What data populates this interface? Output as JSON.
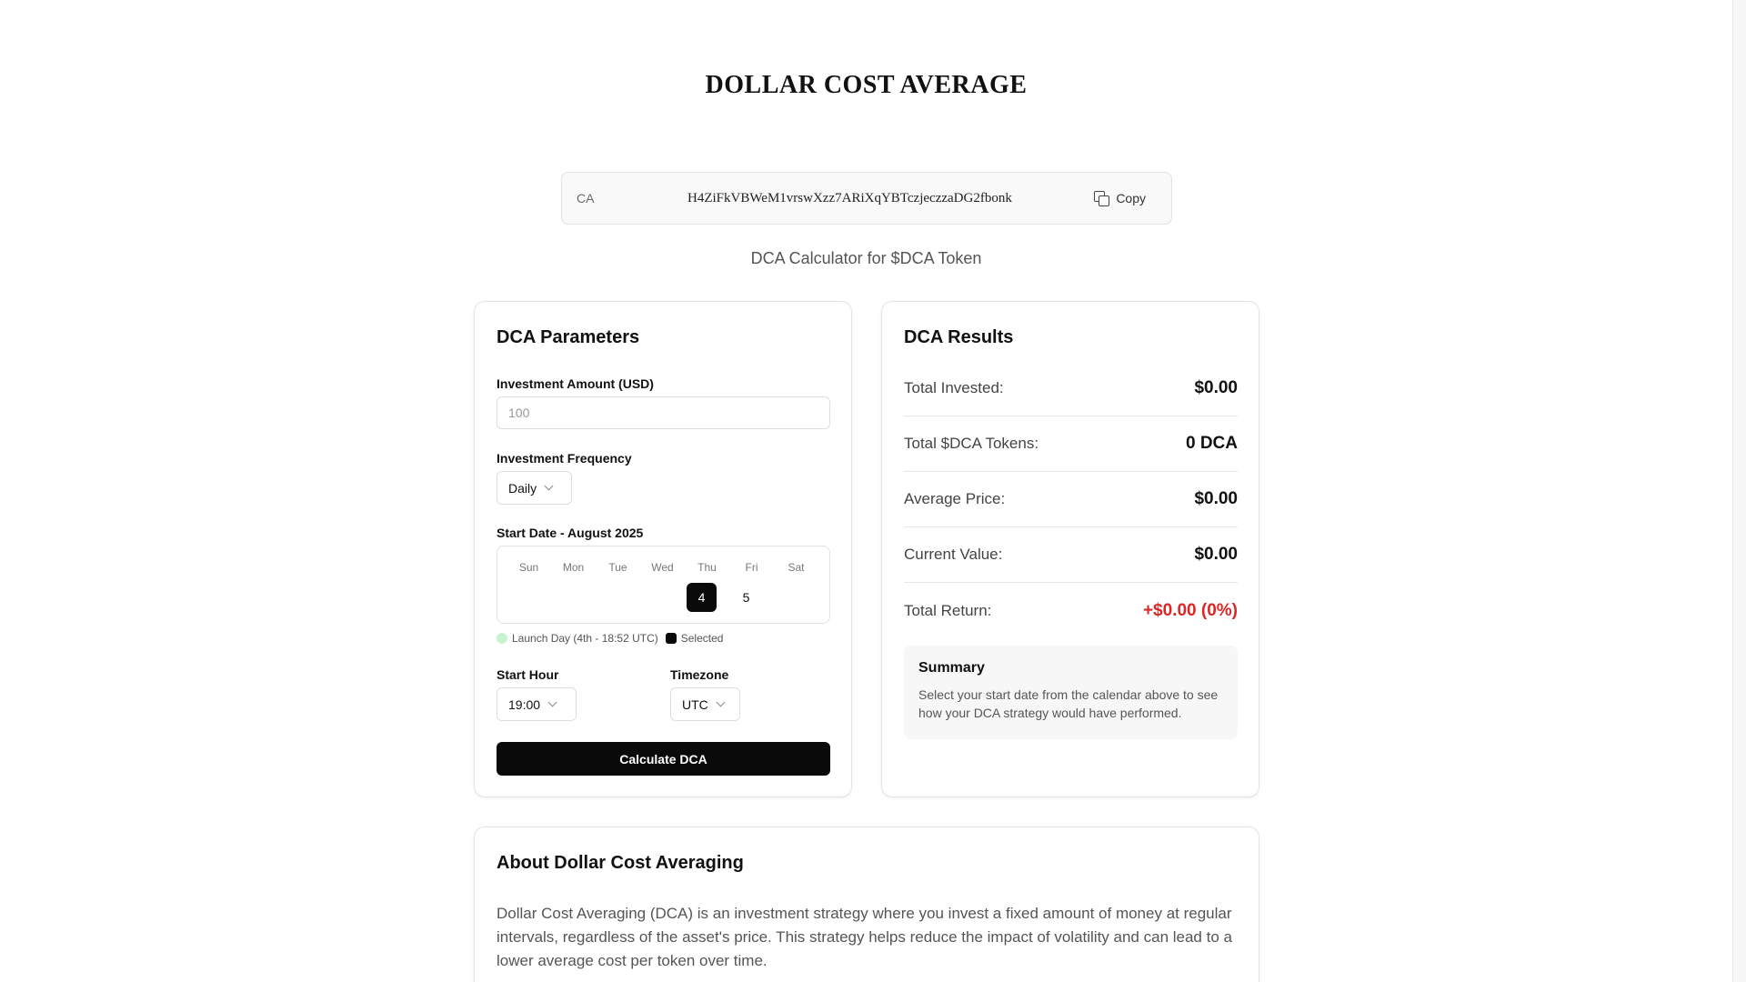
{
  "header": {
    "title": "DOLLAR COST AVERAGE"
  },
  "contract": {
    "label": "CA",
    "address": "H4ZiFkVBWeM1vrswXzz7ARiXqYBTczjeczzaDG2fbonk",
    "copy_label": "Copy"
  },
  "subtitle": "DCA Calculator for $DCA Token",
  "parameters": {
    "title": "DCA Parameters",
    "amount_label": "Investment Amount (USD)",
    "amount_placeholder": "100",
    "frequency_label": "Investment Frequency",
    "frequency_value": "Daily",
    "start_date_label": "Start Date - August 2025",
    "weekdays": [
      "Sun",
      "Mon",
      "Tue",
      "Wed",
      "Thu",
      "Fri",
      "Sat"
    ],
    "days": [
      {
        "day": "4",
        "weekday": "Thu",
        "selected": true
      },
      {
        "day": "5",
        "weekday": "Fri",
        "selected": false
      }
    ],
    "legend_launch": "Launch Day (4th - 18:52 UTC)",
    "legend_selected": "Selected",
    "start_hour_label": "Start Hour",
    "start_hour_value": "19:00",
    "timezone_label": "Timezone",
    "timezone_value": "UTC",
    "calculate_label": "Calculate DCA"
  },
  "results": {
    "title": "DCA Results",
    "rows": [
      {
        "label": "Total Invested:",
        "value": "$0.00"
      },
      {
        "label": "Total $DCA Tokens:",
        "value": "0 DCA"
      },
      {
        "label": "Average Price:",
        "value": "$0.00"
      },
      {
        "label": "Current Value:",
        "value": "$0.00"
      },
      {
        "label": "Total Return:",
        "value": "+$0.00 (0%)"
      }
    ],
    "summary_title": "Summary",
    "summary_text": "Select your start date from the calendar above to see how your DCA strategy would have performed."
  },
  "about": {
    "title": "About Dollar Cost Averaging",
    "text": "Dollar Cost Averaging (DCA) is an investment strategy where you invest a fixed amount of money at regular intervals, regardless of the asset's price. This strategy helps reduce the impact of volatility and can lead to a lower average cost per token over time."
  },
  "colors": {
    "accent": "#0a0a0a",
    "negative": "#dc2626",
    "launch_day": "#c8f3d2"
  },
  "icons": {
    "copy": "copy-icon",
    "dropdown": "chevron-down-icon"
  }
}
